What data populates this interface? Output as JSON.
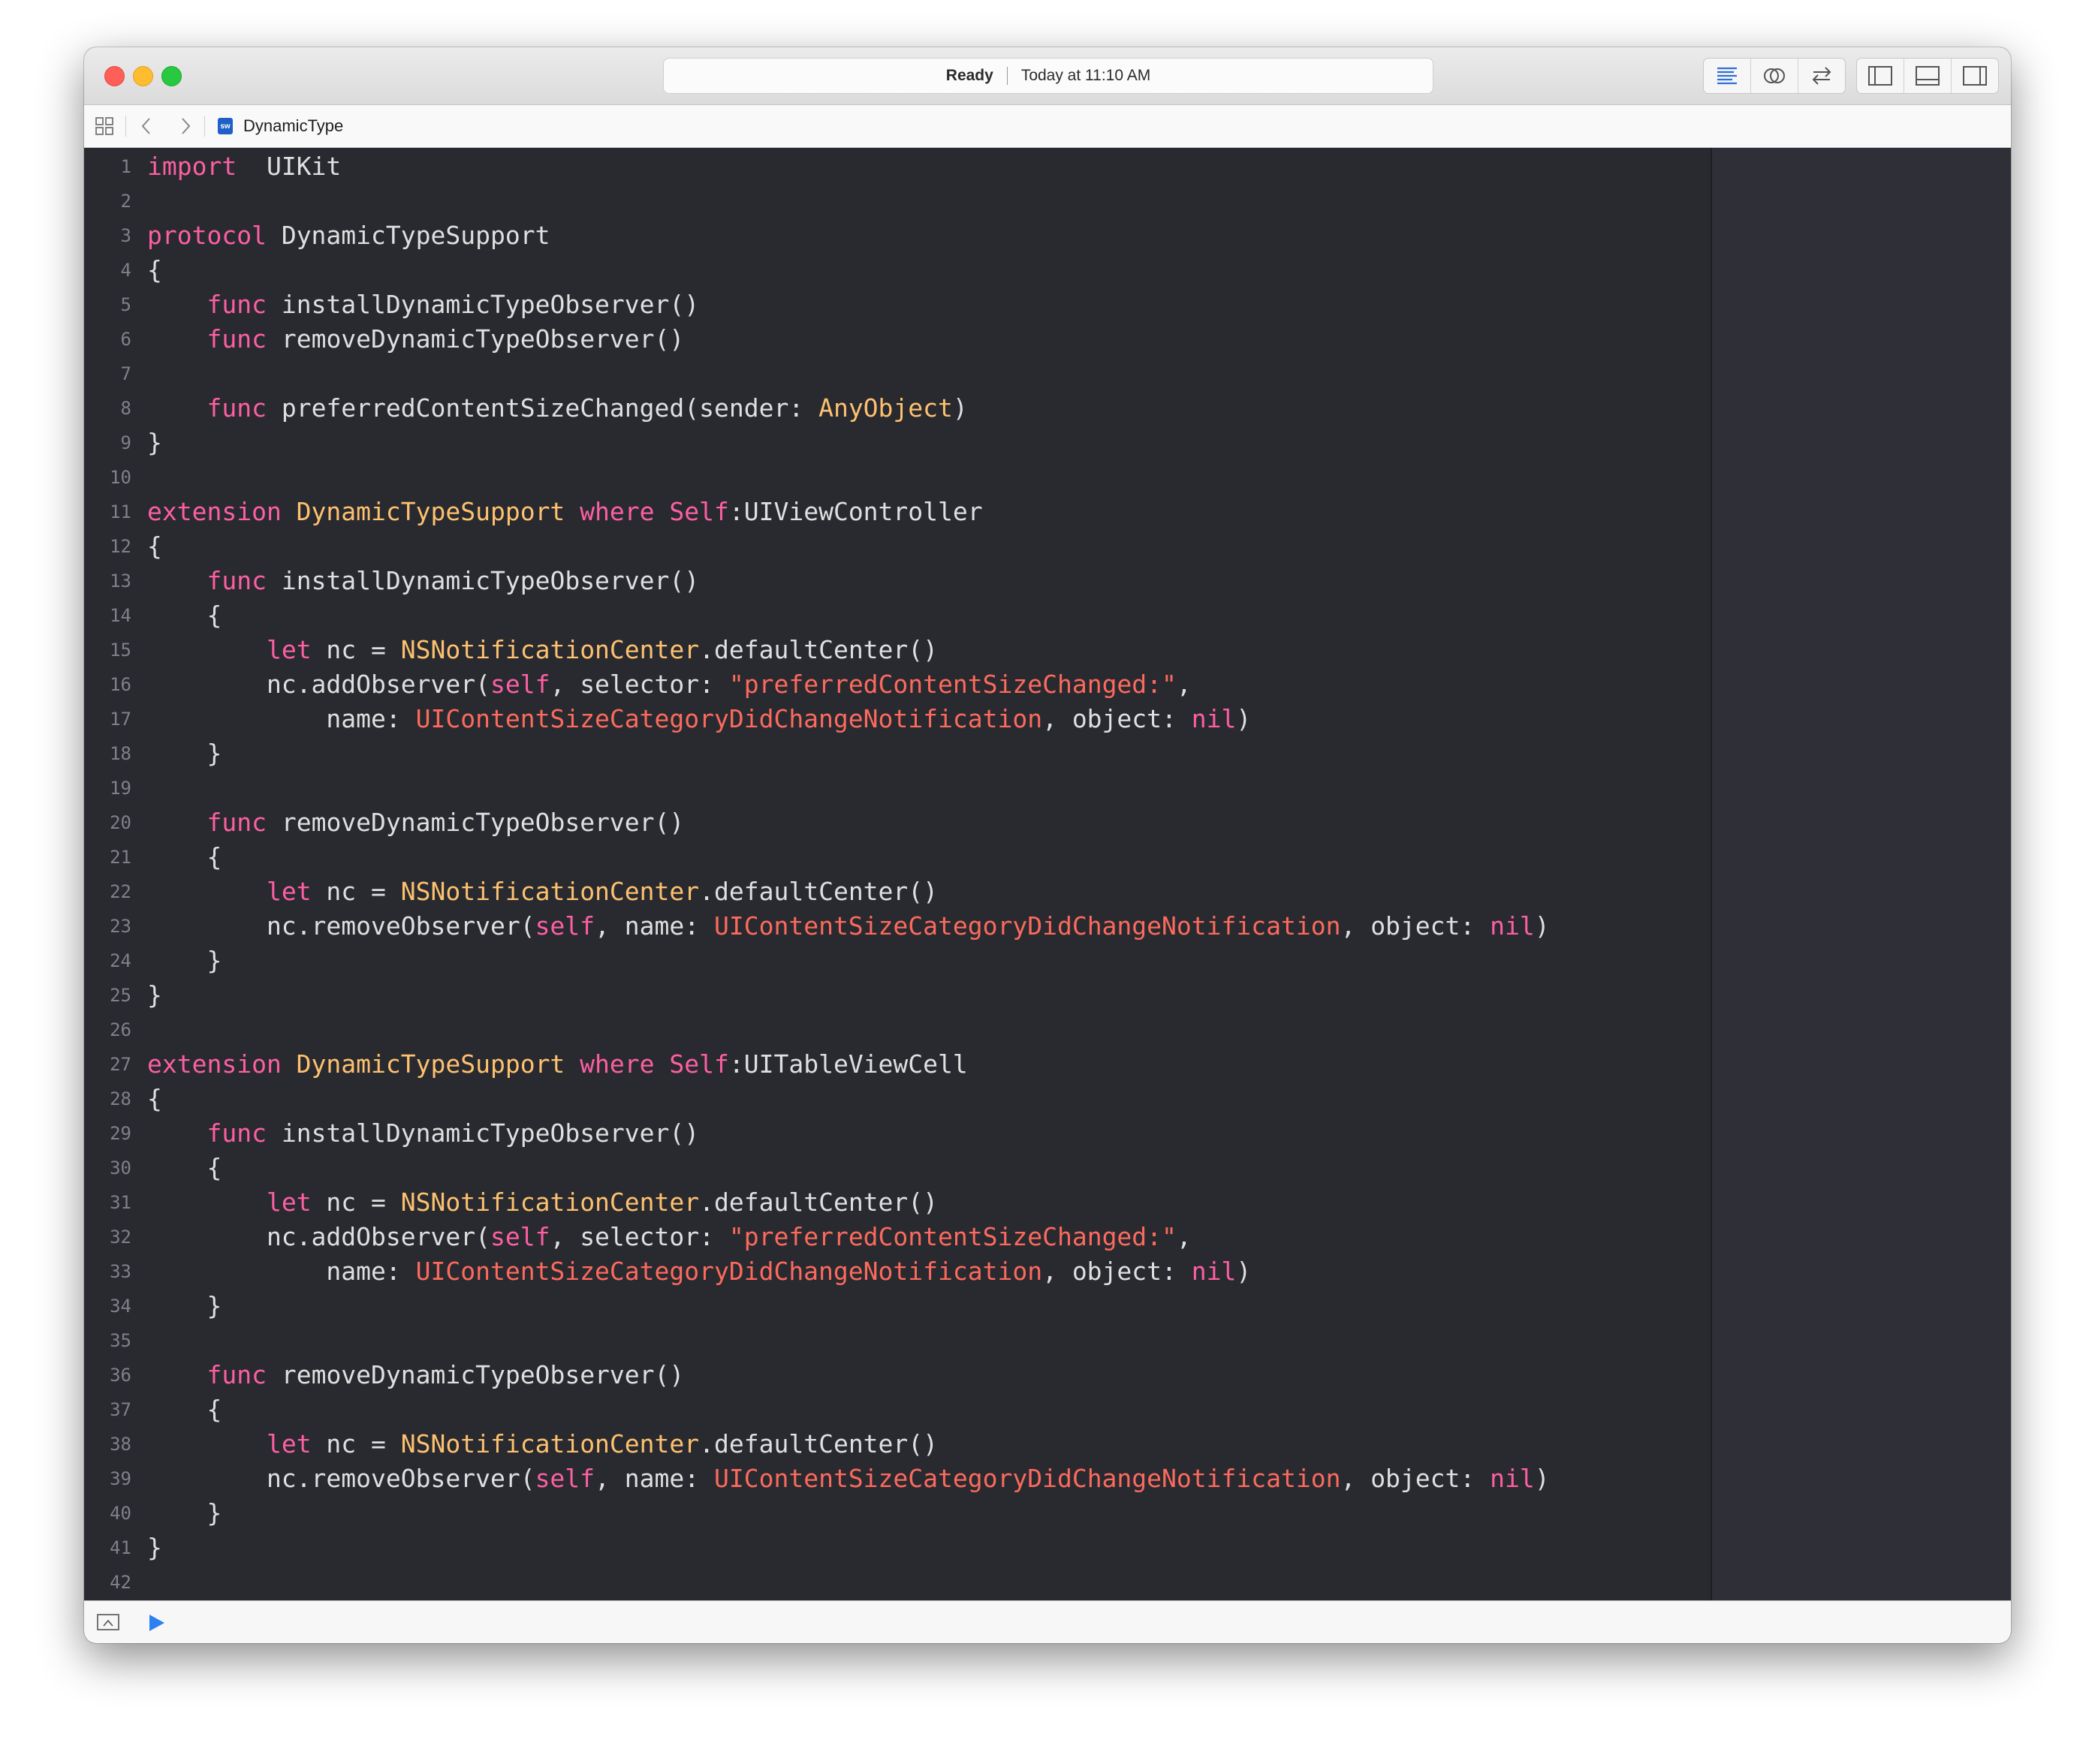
{
  "window": {
    "status": "Ready",
    "timestamp": "Today at 11:10 AM"
  },
  "toolbar": {
    "editor_buttons": [
      "standard-editor-icon",
      "assistant-editor-icon",
      "version-editor-icon"
    ],
    "view_buttons": [
      "navigator-panel-icon",
      "debug-area-icon",
      "utilities-panel-icon"
    ]
  },
  "jumpbar": {
    "file_name": "DynamicType",
    "file_badge": "sw"
  },
  "theme": {
    "background": "#292a30",
    "keyword": "#fc5fa3",
    "type": "#fdc16f",
    "string": "#fc6a5d",
    "default": "#dfdfe0"
  },
  "code": {
    "lines": [
      [
        [
          "kw",
          "import"
        ],
        [
          "",
          "  UIKit"
        ]
      ],
      [],
      [
        [
          "kw",
          "protocol"
        ],
        [
          "",
          " DynamicTypeSupport"
        ]
      ],
      [
        [
          "",
          "{"
        ]
      ],
      [
        [
          "",
          "    "
        ],
        [
          "kw",
          "func"
        ],
        [
          "",
          " installDynamicTypeObserver()"
        ]
      ],
      [
        [
          "",
          "    "
        ],
        [
          "kw",
          "func"
        ],
        [
          "",
          " removeDynamicTypeObserver()"
        ]
      ],
      [],
      [
        [
          "",
          "    "
        ],
        [
          "kw",
          "func"
        ],
        [
          "",
          " preferredContentSizeChanged(sender: "
        ],
        [
          "ty",
          "AnyObject"
        ],
        [
          "",
          ")"
        ]
      ],
      [
        [
          "",
          "}"
        ]
      ],
      [],
      [
        [
          "kw",
          "extension"
        ],
        [
          "",
          ""
        ],
        [
          "ty",
          " DynamicTypeSupport"
        ],
        [
          "kw",
          " where"
        ],
        [
          "kw",
          " Self"
        ],
        [
          "",
          ":UIViewController"
        ]
      ],
      [
        [
          "",
          "{"
        ]
      ],
      [
        [
          "",
          "    "
        ],
        [
          "kw",
          "func"
        ],
        [
          "",
          " installDynamicTypeObserver()"
        ]
      ],
      [
        [
          "",
          "    {"
        ]
      ],
      [
        [
          "",
          "        "
        ],
        [
          "kw",
          "let"
        ],
        [
          "",
          " nc = "
        ],
        [
          "ty",
          "NSNotificationCenter"
        ],
        [
          "",
          ".defaultCenter()"
        ]
      ],
      [
        [
          "",
          "        nc.addObserver("
        ],
        [
          "kw",
          "self"
        ],
        [
          "",
          ", selector: "
        ],
        [
          "st",
          "\"preferredContentSizeChanged:\""
        ],
        [
          "",
          ","
        ]
      ],
      [
        [
          "",
          "            name: "
        ],
        [
          "st",
          "UIContentSizeCategoryDidChangeNotification"
        ],
        [
          "",
          ", object: "
        ],
        [
          "kw",
          "nil"
        ],
        [
          "",
          ")"
        ]
      ],
      [
        [
          "",
          "    }"
        ]
      ],
      [],
      [
        [
          "",
          "    "
        ],
        [
          "kw",
          "func"
        ],
        [
          "",
          " removeDynamicTypeObserver()"
        ]
      ],
      [
        [
          "",
          "    {"
        ]
      ],
      [
        [
          "",
          "        "
        ],
        [
          "kw",
          "let"
        ],
        [
          "",
          " nc = "
        ],
        [
          "ty",
          "NSNotificationCenter"
        ],
        [
          "",
          ".defaultCenter()"
        ]
      ],
      [
        [
          "",
          "        nc.removeObserver("
        ],
        [
          "kw",
          "self"
        ],
        [
          "",
          ", name: "
        ],
        [
          "st",
          "UIContentSizeCategoryDidChangeNotification"
        ],
        [
          "",
          ", object: "
        ],
        [
          "kw",
          "nil"
        ],
        [
          "",
          ")"
        ]
      ],
      [
        [
          "",
          "    }"
        ]
      ],
      [
        [
          "",
          "}"
        ]
      ],
      [],
      [
        [
          "kw",
          "extension"
        ],
        [
          "ty",
          " DynamicTypeSupport"
        ],
        [
          "kw",
          " where"
        ],
        [
          "kw",
          " Self"
        ],
        [
          "",
          ":UITableViewCell"
        ]
      ],
      [
        [
          "",
          "{"
        ]
      ],
      [
        [
          "",
          "    "
        ],
        [
          "kw",
          "func"
        ],
        [
          "",
          " installDynamicTypeObserver()"
        ]
      ],
      [
        [
          "",
          "    {"
        ]
      ],
      [
        [
          "",
          "        "
        ],
        [
          "kw",
          "let"
        ],
        [
          "",
          " nc = "
        ],
        [
          "ty",
          "NSNotificationCenter"
        ],
        [
          "",
          ".defaultCenter()"
        ]
      ],
      [
        [
          "",
          "        nc.addObserver("
        ],
        [
          "kw",
          "self"
        ],
        [
          "",
          ", selector: "
        ],
        [
          "st",
          "\"preferredContentSizeChanged:\""
        ],
        [
          "",
          ","
        ]
      ],
      [
        [
          "",
          "            name: "
        ],
        [
          "st",
          "UIContentSizeCategoryDidChangeNotification"
        ],
        [
          "",
          ", object: "
        ],
        [
          "kw",
          "nil"
        ],
        [
          "",
          ")"
        ]
      ],
      [
        [
          "",
          "    }"
        ]
      ],
      [],
      [
        [
          "",
          "    "
        ],
        [
          "kw",
          "func"
        ],
        [
          "",
          " removeDynamicTypeObserver()"
        ]
      ],
      [
        [
          "",
          "    {"
        ]
      ],
      [
        [
          "",
          "        "
        ],
        [
          "kw",
          "let"
        ],
        [
          "",
          " nc = "
        ],
        [
          "ty",
          "NSNotificationCenter"
        ],
        [
          "",
          ".defaultCenter()"
        ]
      ],
      [
        [
          "",
          "        nc.removeObserver("
        ],
        [
          "kw",
          "self"
        ],
        [
          "",
          ", name: "
        ],
        [
          "st",
          "UIContentSizeCategoryDidChangeNotification"
        ],
        [
          "",
          ", object: "
        ],
        [
          "kw",
          "nil"
        ],
        [
          "",
          ")"
        ]
      ],
      [
        [
          "",
          "    }"
        ]
      ],
      [
        [
          "",
          "}"
        ]
      ],
      []
    ]
  },
  "debug": {
    "left_icon": "hide-debug-area-icon",
    "run_icon": "continue-icon"
  }
}
